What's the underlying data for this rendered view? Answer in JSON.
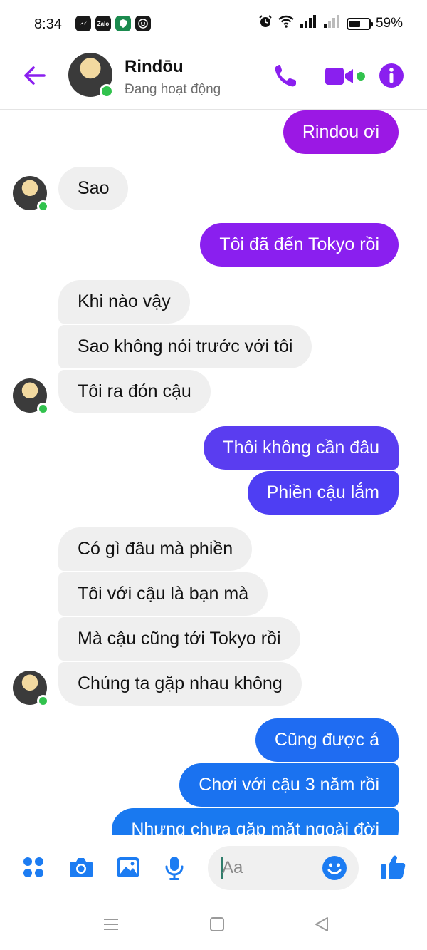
{
  "status_bar": {
    "time": "8:34",
    "app_icons": [
      "messenger-icon",
      "Zalo",
      "vpn-shield-icon",
      "smiley-app-icon"
    ],
    "battery_label": "59%",
    "battery_level": 0.59
  },
  "header": {
    "name": "Rindōu",
    "status": "Đang hoạt động"
  },
  "messages": [
    {
      "side": "out",
      "text": "Rindou ơi",
      "color": "#9b18e4"
    },
    {
      "side": "in",
      "text": "Sao"
    },
    {
      "side": "out",
      "text": "Tôi đã đến Tokyo rồi",
      "color": "#8a1fef"
    },
    {
      "side": "in",
      "text": "Khi nào vậy"
    },
    {
      "side": "in",
      "text": "Sao không nói trước với tôi"
    },
    {
      "side": "in",
      "text": "Tôi ra đón cậu"
    },
    {
      "side": "out",
      "text": "Thôi không cần đâu",
      "color": "#5a3df0"
    },
    {
      "side": "out",
      "text": "Phiền cậu lắm",
      "color": "#4e3ef3"
    },
    {
      "side": "in",
      "text": "Có gì đâu mà phiền"
    },
    {
      "side": "in",
      "text": "Tôi với cậu là bạn mà"
    },
    {
      "side": "in",
      "text": "Mà cậu cũng tới Tokyo rồi"
    },
    {
      "side": "in",
      "text": "Chúng ta gặp nhau không"
    },
    {
      "side": "out",
      "text": "Cũng được á",
      "color": "#1f6cf2"
    },
    {
      "side": "out",
      "text": "Chơi với cậu 3 năm rồi",
      "color": "#1a72f0"
    },
    {
      "side": "out",
      "text": "Nhưng chưa gặp mặt ngoài đời",
      "color": "#1979f0"
    }
  ],
  "composer": {
    "placeholder": "Aa"
  },
  "colors": {
    "accent_purple": "#8a1fef",
    "accent_blue": "#1c7cf2",
    "incoming_bubble": "#efefef",
    "online_dot": "#31c24d"
  }
}
